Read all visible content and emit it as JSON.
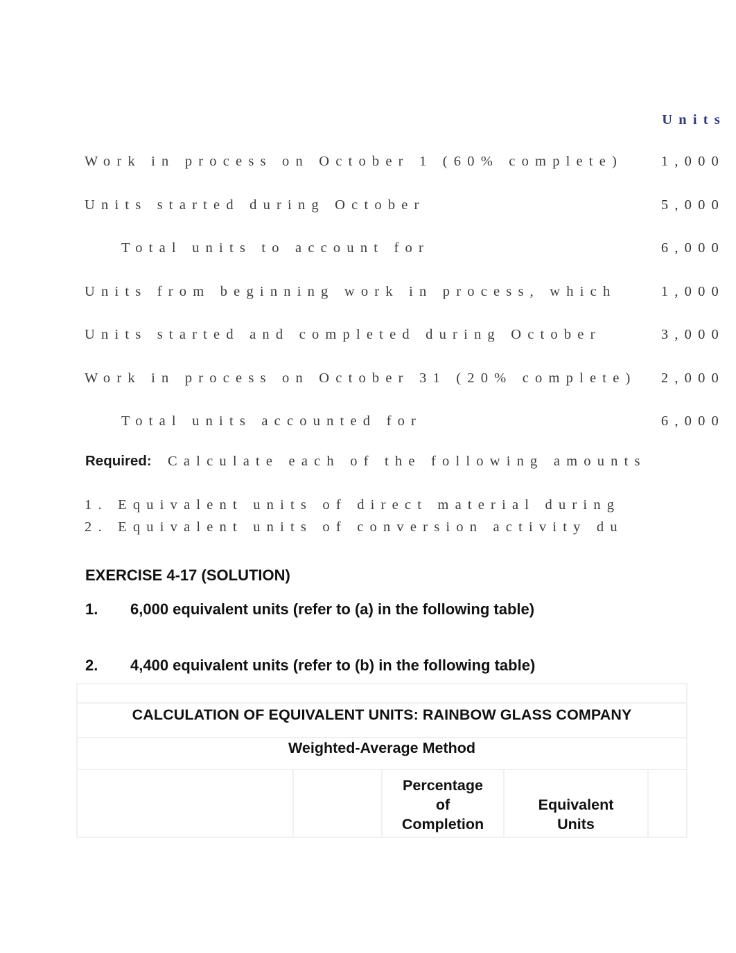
{
  "document": {
    "column_header": "Units",
    "lines": [
      {
        "label": "Work in process on October 1 (60% complete)",
        "value": "1,000",
        "indent": false
      },
      {
        "label": "Units started during October",
        "value": "5,000",
        "indent": false
      },
      {
        "label": "Total units to account for",
        "value": "6,000",
        "indent": true
      },
      {
        "label": "Units from beginning work in process, which",
        "value": "1,000",
        "indent": false
      },
      {
        "label": "Units started and completed during October",
        "value": "3,000",
        "indent": false
      },
      {
        "label": "Work in process on October 31 (20% complete)",
        "value": "2,000",
        "indent": false
      },
      {
        "label": "Total units accounted for",
        "value": "6,000",
        "indent": true
      }
    ],
    "required": {
      "label": "Required:",
      "text": "Calculate each of the following amounts",
      "items": [
        "1. Equivalent units of direct material during",
        "2. Equivalent units of conversion activity du"
      ]
    }
  },
  "solution": {
    "heading": "EXERCISE 4-17 (SOLUTION)",
    "answers": [
      {
        "marker": "1.",
        "text": "6,000 equivalent units (refer to (a) in the following table)"
      },
      {
        "marker": "2.",
        "text": "4,400 equivalent units (refer to (b) in the following table)"
      }
    ]
  },
  "table": {
    "title": "CALCULATION OF EQUIVALENT UNITS: RAINBOW GLASS COMPANY",
    "subtitle": "Weighted-Average Method",
    "headers": {
      "description": "",
      "physical_units": "",
      "percentage_of_completion": "Percentage\nof\nCompletion",
      "equivalent_units": "Equivalent\nUnits",
      "last": ""
    }
  },
  "colors": {
    "header_blue": "#2e3a8c",
    "body_text": "#3a3a44",
    "heading_black": "#111111",
    "grid_line": "#f0f0f0",
    "page_background": "#ffffff"
  }
}
